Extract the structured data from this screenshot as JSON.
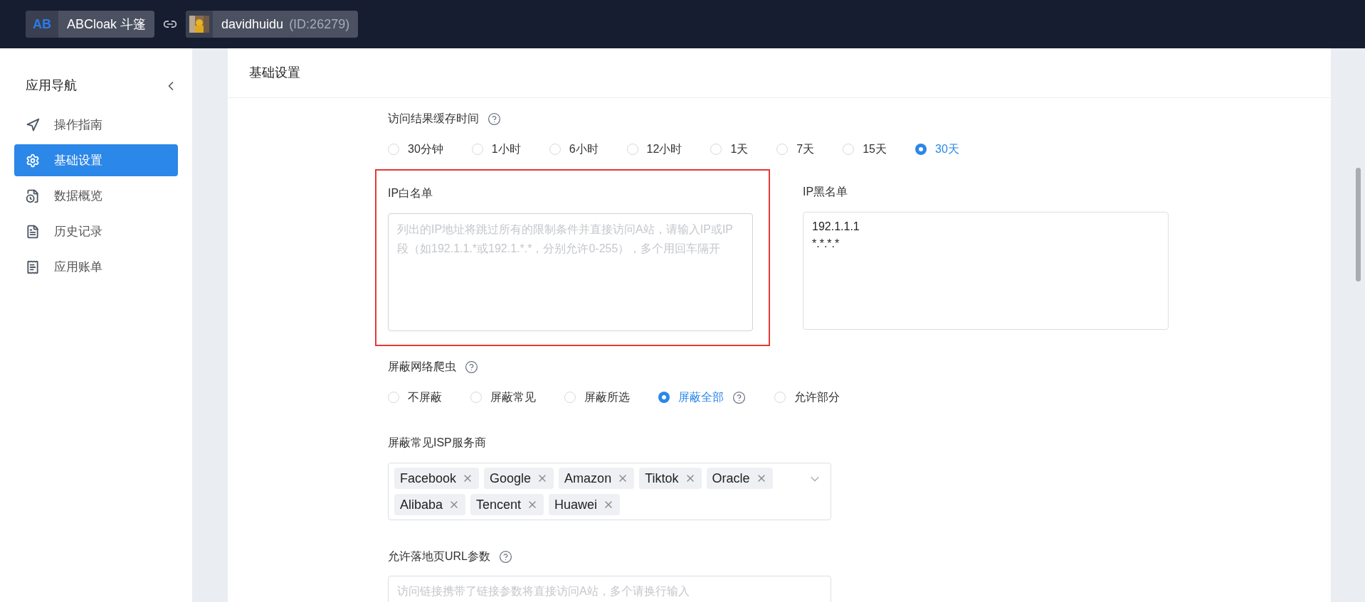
{
  "topbar": {
    "app_logo": "AB",
    "app_name": "ABCloak 斗篷",
    "user_name": "davidhuidu",
    "user_id": "(ID:26279)"
  },
  "sidebar": {
    "title": "应用导航",
    "items": [
      {
        "label": "操作指南",
        "selected": false
      },
      {
        "label": "基础设置",
        "selected": true
      },
      {
        "label": "数据概览",
        "selected": false
      },
      {
        "label": "历史记录",
        "selected": false
      },
      {
        "label": "应用账单",
        "selected": false
      }
    ]
  },
  "card": {
    "title": "基础设置"
  },
  "cache_time": {
    "label": "访问结果缓存时间",
    "options": [
      {
        "label": "30分钟",
        "selected": false
      },
      {
        "label": "1小时",
        "selected": false
      },
      {
        "label": "6小时",
        "selected": false
      },
      {
        "label": "12小时",
        "selected": false
      },
      {
        "label": "1天",
        "selected": false
      },
      {
        "label": "7天",
        "selected": false
      },
      {
        "label": "15天",
        "selected": false
      },
      {
        "label": "30天",
        "selected": true
      }
    ]
  },
  "ip_whitelist": {
    "label": "IP白名单",
    "placeholder": "列出的IP地址将跳过所有的限制条件并直接访问A站，请输入IP或IP段（如192.1.1.*或192.1.*.*，分别允许0-255），多个用回车隔开",
    "highlighted": true
  },
  "ip_blacklist": {
    "label": "IP黑名单",
    "lines": [
      "192.1.1.1",
      "*.*.*.*"
    ]
  },
  "block_crawlers": {
    "label": "屏蔽网络爬虫",
    "options": [
      {
        "label": "不屏蔽",
        "selected": false,
        "help": false
      },
      {
        "label": "屏蔽常见",
        "selected": false,
        "help": false
      },
      {
        "label": "屏蔽所选",
        "selected": false,
        "help": false
      },
      {
        "label": "屏蔽全部",
        "selected": true,
        "help": true
      },
      {
        "label": "允许部分",
        "selected": false,
        "help": false
      }
    ]
  },
  "block_isp": {
    "label": "屏蔽常见ISP服务商",
    "tags": [
      "Facebook",
      "Google",
      "Amazon",
      "Tiktok",
      "Oracle",
      "Alibaba",
      "Tencent",
      "Huawei"
    ]
  },
  "url_params": {
    "label": "允许落地页URL参数",
    "placeholder": "访问链接携带了链接参数将直接访问A站，多个请换行输入"
  }
}
